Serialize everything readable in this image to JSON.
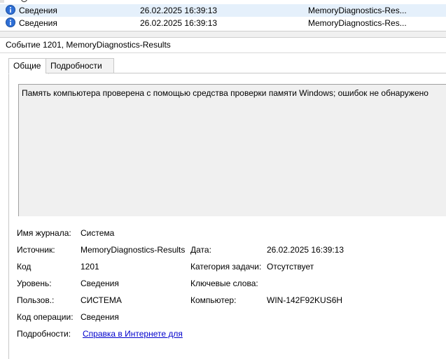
{
  "events": [
    {
      "level": "Сведения",
      "date": "26.02.2025 16:39:13",
      "source": "MemoryDiagnostics-Res..."
    },
    {
      "level": "Сведения",
      "date": "26.02.2025 16:39:13",
      "source": "MemoryDiagnostics-Res..."
    }
  ],
  "event_title": "Событие 1201, MemoryDiagnostics-Results",
  "tabs": {
    "general": "Общие",
    "details": "Подробности"
  },
  "description": "Память компьютера проверена с помощью средства проверки памяти Windows; ошибок не обнаружено",
  "fields": {
    "log_name_label": "Имя журнала:",
    "log_name": "Система",
    "source_label": "Источник:",
    "source": "MemoryDiagnostics-Results",
    "date_label": "Дата:",
    "date": "26.02.2025 16:39:13",
    "code_label": "Код",
    "code": "1201",
    "task_label": "Категория задачи:",
    "task": "Отсутствует",
    "level_label": "Уровень:",
    "level": "Сведения",
    "keywords_label": "Ключевые слова:",
    "user_label": "Пользов.:",
    "user": "СИСТЕМА",
    "computer_label": "Компьютер:",
    "computer": "WIN-142F92KUS6H",
    "opcode_label": "Код операции:",
    "opcode": "Сведения",
    "more_label": "Подробности:",
    "more_link": "Справка в Интернете для"
  },
  "colors": {
    "info_icon": "#2e6fd6",
    "selected_row": "#e5f0fb",
    "link": "#0000cc"
  },
  "icons": {
    "info": "info-icon"
  }
}
